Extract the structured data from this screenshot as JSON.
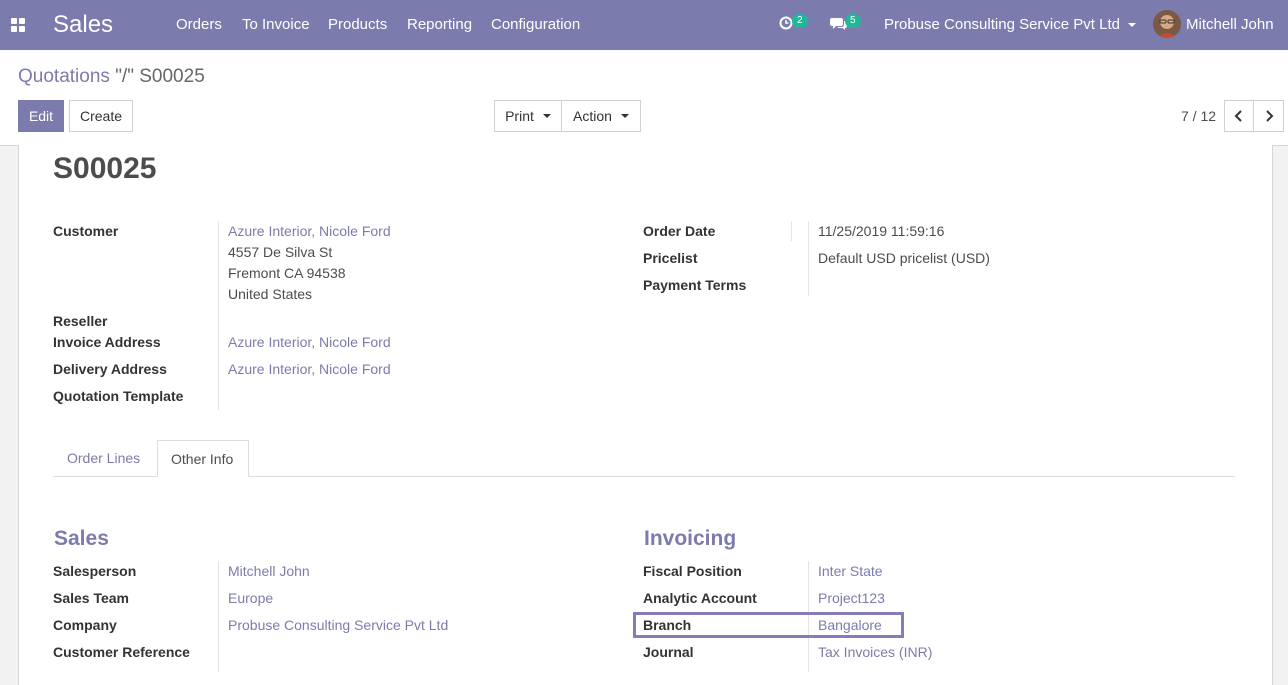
{
  "navbar": {
    "brand": "Sales",
    "menu": [
      "Orders",
      "To Invoice",
      "Products",
      "Reporting",
      "Configuration"
    ],
    "activity_count": "2",
    "message_count": "5",
    "company": "Probuse Consulting Service Pvt Ltd",
    "user": "Mitchell John"
  },
  "breadcrumb": {
    "parent": "Quotations",
    "separator": "\"/\"",
    "current": "S00025"
  },
  "buttons": {
    "edit": "Edit",
    "create": "Create",
    "print": "Print",
    "action": "Action"
  },
  "pager": {
    "value": "7 / 12"
  },
  "record": {
    "name": "S00025",
    "customer_label": "Customer",
    "customer_name": "Azure Interior, Nicole Ford",
    "address_line1": "4557 De Silva St",
    "address_line2": "Fremont CA 94538",
    "address_line3": "United States",
    "reseller_label": "Reseller",
    "invoice_address_label": "Invoice Address",
    "invoice_address": "Azure Interior, Nicole Ford",
    "delivery_address_label": "Delivery Address",
    "delivery_address": "Azure Interior, Nicole Ford",
    "template_label": "Quotation Template",
    "order_date_label": "Order Date",
    "order_date": "11/25/2019 11:59:16",
    "pricelist_label": "Pricelist",
    "pricelist": "Default USD pricelist (USD)",
    "payment_terms_label": "Payment Terms"
  },
  "tabs": [
    "Order Lines",
    "Other Info"
  ],
  "sales": {
    "title": "Sales",
    "salesperson_label": "Salesperson",
    "salesperson": "Mitchell John",
    "team_label": "Sales Team",
    "team": "Europe",
    "company_label": "Company",
    "company": "Probuse Consulting Service Pvt Ltd",
    "customer_ref_label": "Customer Reference"
  },
  "invoicing": {
    "title": "Invoicing",
    "fiscal_position_label": "Fiscal Position",
    "fiscal_position": "Inter State",
    "analytic_account_label": "Analytic Account",
    "analytic_account": "Project123",
    "branch_label": "Branch",
    "branch": "Bangalore",
    "journal_label": "Journal",
    "journal": "Tax Invoices (INR)"
  }
}
